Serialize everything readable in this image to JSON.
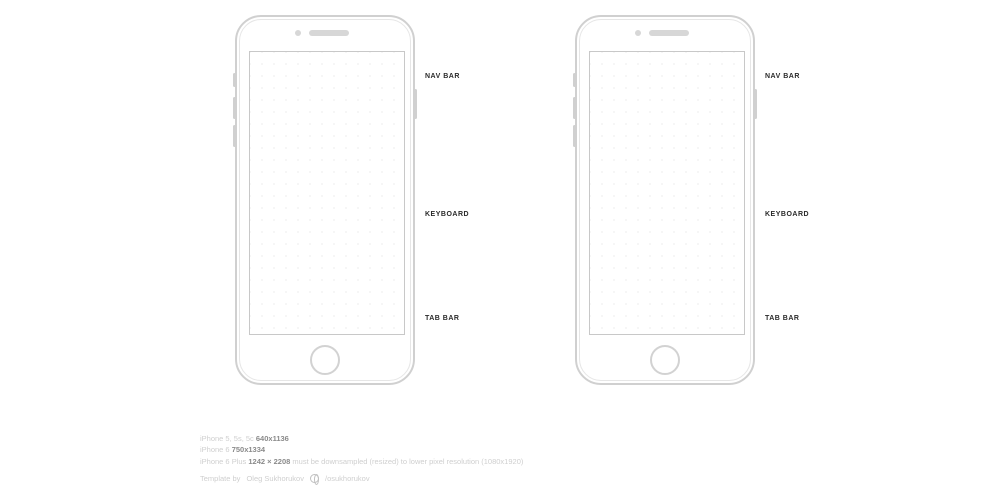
{
  "annotations": {
    "nav_bar": "NAV BAR",
    "keyboard": "KEYBOARD",
    "tab_bar": "TAB BAR"
  },
  "footer": {
    "line1_label": "iPhone 5, 5s, 5c",
    "line1_value": "640x1136",
    "line2_label": "iPhone 6",
    "line2_value": "750x1334",
    "line3_label": "iPhone 6 Plus",
    "line3_value": "1242 × 2208",
    "line3_note": "must be downsampled (resized) to lower pixel resolution (1080x1920)",
    "credit_prefix": "Template by",
    "credit_author": "Oleg Sukhorukov",
    "credit_handle": "/osukhorukov"
  }
}
